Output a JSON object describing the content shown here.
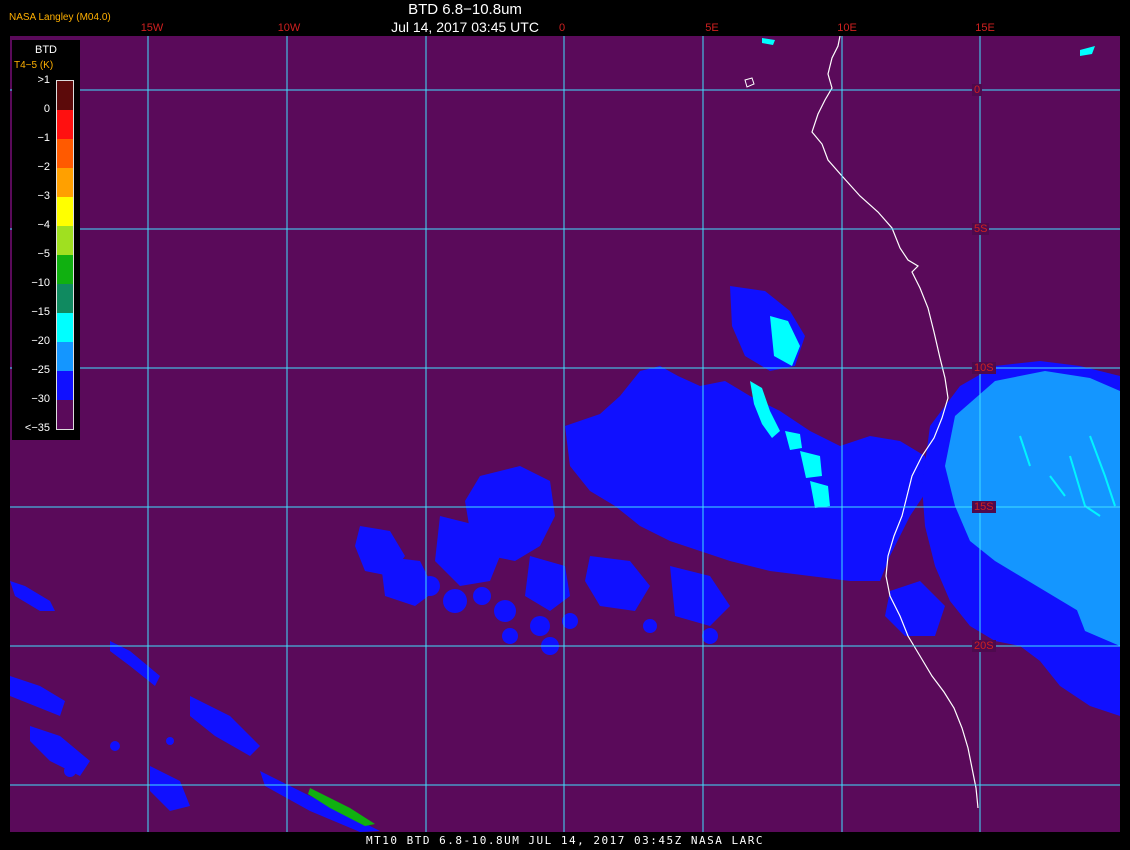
{
  "header": {
    "credit": "NASA Langley (M04.0)",
    "title": "BTD 6.8−10.8um",
    "datetime": "Jul 14, 2017 03:45 UTC"
  },
  "longitude_labels": [
    "15W",
    "10W",
    "0",
    "5E",
    "10E",
    "15E"
  ],
  "latitude_labels": [
    "0",
    "5S",
    "10S",
    "15S",
    "20S"
  ],
  "legend": {
    "title": "BTD",
    "subtitle": "T4−5 (K)",
    "ticks": [
      ">1",
      "0",
      "−1",
      "−2",
      "−3",
      "−4",
      "−5",
      "−10",
      "−15",
      "−20",
      "−25",
      "−30",
      "<−35"
    ],
    "colors": [
      "#5c0a0a",
      "#ff1010",
      "#ff5a00",
      "#ffa000",
      "#ffff00",
      "#a0e020",
      "#10b010",
      "#108a60",
      "#00ffff",
      "#1496ff",
      "#1010ff",
      "#5a0a5a"
    ]
  },
  "colors": {
    "background": "#5a0a5a",
    "grid": "#40e0ff",
    "coastline": "#ffffff",
    "low_cloud": "#1010ff",
    "mid_cloud": "#1496ff",
    "cyan_cloud": "#00ffff"
  },
  "footer": {
    "text": "MT10  BTD 6.8-10.8UM   JUL 14, 2017 03:45Z   NASA LARC"
  }
}
